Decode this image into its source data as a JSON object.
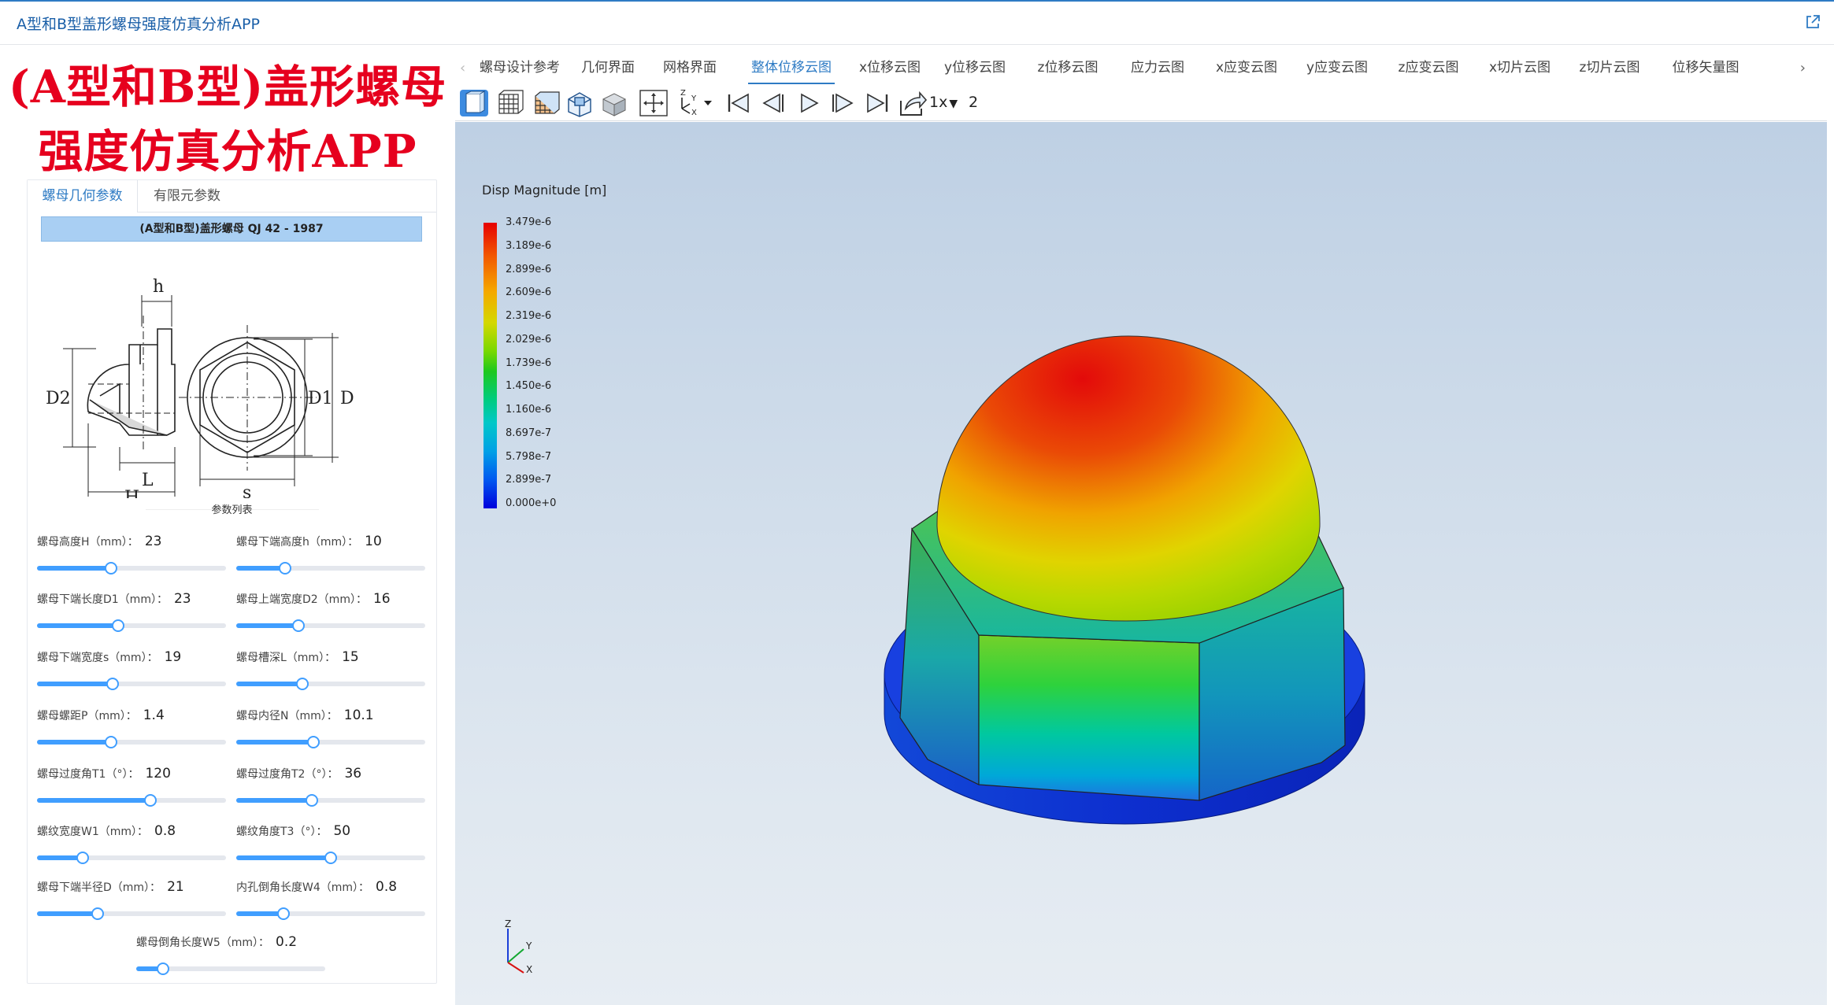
{
  "app_title": "A型和B型盖形螺母强度仿真分析APP",
  "banner": {
    "line1": "(A型和B型)盖形螺母",
    "line2": "强度仿真分析APP"
  },
  "left_tabs": [
    {
      "label": "螺母几何参数",
      "active": true
    },
    {
      "label": "有限元参数",
      "active": false
    }
  ],
  "standard": "(A型和B型)盖形螺母 QJ 42 - 1987",
  "drawing_labels": {
    "h": "h",
    "D2": "D2",
    "D1": "D1",
    "D": "D",
    "L": "L",
    "H": "H",
    "s": "s"
  },
  "params_title": "参数列表",
  "params": [
    {
      "label": "螺母高度H（mm）：",
      "value": "23",
      "fraction": 0.39
    },
    {
      "label": "螺母下端高度h（mm）：",
      "value": "10",
      "fraction": 0.26
    },
    {
      "label": "螺母下端长度D1（mm）：",
      "value": "23",
      "fraction": 0.43
    },
    {
      "label": "螺母上端宽度D2（mm）：",
      "value": "16",
      "fraction": 0.33
    },
    {
      "label": "螺母下端宽度s（mm）：",
      "value": "19",
      "fraction": 0.4
    },
    {
      "label": "螺母槽深L（mm）：",
      "value": "15",
      "fraction": 0.35
    },
    {
      "label": "螺母螺距P（mm）：",
      "value": "1.4",
      "fraction": 0.39
    },
    {
      "label": "螺母内径N（mm）：",
      "value": "10.1",
      "fraction": 0.41
    },
    {
      "label": "螺母过度角T1（°）：",
      "value": "120",
      "fraction": 0.6
    },
    {
      "label": "螺母过度角T2（°）：",
      "value": "36",
      "fraction": 0.4
    },
    {
      "label": "螺纹宽度W1（mm）：",
      "value": "0.8",
      "fraction": 0.24
    },
    {
      "label": "螺纹角度T3（°）：",
      "value": "50",
      "fraction": 0.5
    },
    {
      "label": "螺母下端半径D（mm）：",
      "value": "21",
      "fraction": 0.32
    },
    {
      "label": "内孔倒角长度W4（mm）：",
      "value": "0.8",
      "fraction": 0.25
    },
    {
      "label": "螺母倒角长度W5（mm）：",
      "value": "0.2",
      "fraction": 0.14
    }
  ],
  "view_tabs": [
    {
      "label": "螺母设计参考",
      "active": false
    },
    {
      "label": "几何界面",
      "active": false
    },
    {
      "label": "网格界面",
      "active": false
    },
    {
      "label": "整体位移云图",
      "active": true
    },
    {
      "label": "x位移云图",
      "active": false
    },
    {
      "label": "y位移云图",
      "active": false
    },
    {
      "label": "z位移云图",
      "active": false
    },
    {
      "label": "应力云图",
      "active": false
    },
    {
      "label": "x应变云图",
      "active": false
    },
    {
      "label": "y应变云图",
      "active": false
    },
    {
      "label": "z应变云图",
      "active": false
    },
    {
      "label": "x切片云图",
      "active": false
    },
    {
      "label": "z切片云图",
      "active": false
    },
    {
      "label": "位移矢量图",
      "active": false
    }
  ],
  "toolbar": {
    "speed": "1x",
    "frame": "2"
  },
  "legend": {
    "title": "Disp Magnitude [m]",
    "ticks": [
      "3.479e-6",
      "3.189e-6",
      "2.899e-6",
      "2.609e-6",
      "2.319e-6",
      "2.029e-6",
      "1.739e-6",
      "1.450e-6",
      "1.160e-6",
      "8.697e-7",
      "5.798e-7",
      "2.899e-7",
      "0.000e+0"
    ]
  },
  "axes": {
    "z": "Z",
    "y": "Y",
    "x": "X"
  },
  "colors": {
    "accent": "#2e7bc4",
    "title_red": "#e6001e",
    "banner_blue": "#a9cff3",
    "slider": "#409eff"
  }
}
